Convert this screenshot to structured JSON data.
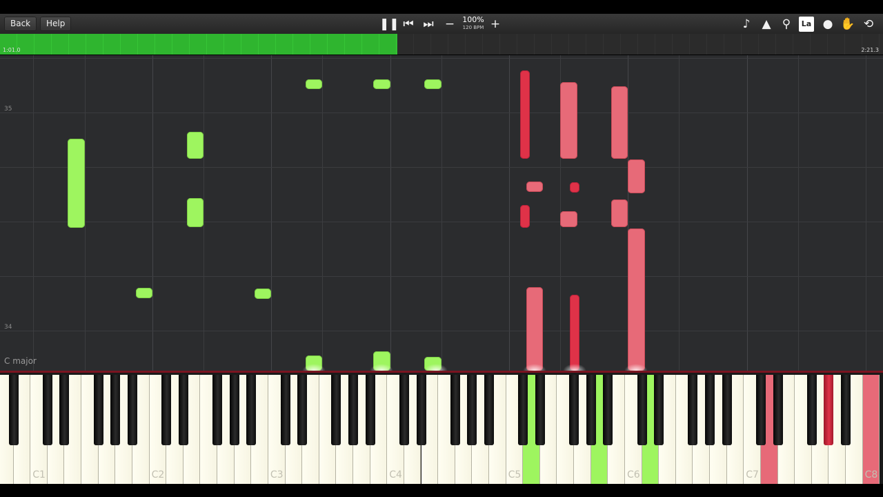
{
  "toolbar": {
    "back_label": "Back",
    "help_label": "Help",
    "zoom_value": "100%",
    "tempo": "120 BPM",
    "icons_center": [
      "pause-icon",
      "skip-back-icon",
      "skip-forward-icon",
      "minus-icon",
      "plus-icon"
    ],
    "icons_right": [
      "note-icon",
      "metronome-icon",
      "magnifier-icon",
      "label-icon",
      "location-pin-icon",
      "hand-icon",
      "loop-icon"
    ],
    "label_icon_text": "La"
  },
  "progress": {
    "elapsed": "1:01.0",
    "total": "2:21.3",
    "fraction": 0.45,
    "fill_color": "#2fb52f"
  },
  "roll": {
    "measure_labels": [
      {
        "number": "35"
      },
      {
        "number": "34"
      }
    ],
    "key_signature": "C major",
    "colors": {
      "left_hand": "#9ef55f",
      "right_hand": "#e76a78",
      "right_hand_dark": "#df3248"
    }
  },
  "keyboard": {
    "octave_labels": [
      "C1",
      "C2",
      "C3",
      "C4",
      "C5",
      "C6",
      "C7",
      "C8"
    ],
    "pressed_white_key_colors": {
      "green": "#9ef55f",
      "red": "#e76a78"
    },
    "pressed_black_key_color": "#df3248"
  }
}
